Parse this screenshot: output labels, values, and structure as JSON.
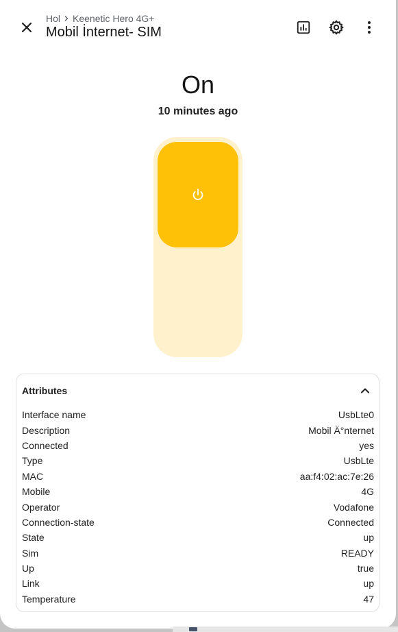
{
  "header": {
    "breadcrumb_area": "Hol",
    "breadcrumb_device": "Keenetic Hero 4G+",
    "title": "Mobil İnternet- SIM",
    "icons": {
      "close": "close-icon",
      "history": "chart-bar-icon",
      "settings": "gear-icon",
      "menu": "dots-vertical-icon"
    }
  },
  "entity": {
    "state": "On",
    "last_changed": "10 minutes ago",
    "switch_on": true,
    "switch_icon": "power-icon",
    "accent_color": "#ffc107",
    "track_color": "#fff1cc"
  },
  "attributes": {
    "title": "Attributes",
    "expanded": true,
    "rows": [
      {
        "name": "Interface name",
        "value": "UsbLte0"
      },
      {
        "name": "Description",
        "value": "Mobil Ä°nternet"
      },
      {
        "name": "Connected",
        "value": "yes"
      },
      {
        "name": "Type",
        "value": "UsbLte"
      },
      {
        "name": "MAC",
        "value": "aa:f4:02:ac:7e:26"
      },
      {
        "name": "Mobile",
        "value": "4G"
      },
      {
        "name": "Operator",
        "value": "Vodafone"
      },
      {
        "name": "Connection-state",
        "value": "Connected"
      },
      {
        "name": "State",
        "value": "up"
      },
      {
        "name": "Sim",
        "value": "READY"
      },
      {
        "name": "Up",
        "value": "true"
      },
      {
        "name": "Link",
        "value": "up"
      },
      {
        "name": "Temperature",
        "value": "47"
      }
    ]
  }
}
